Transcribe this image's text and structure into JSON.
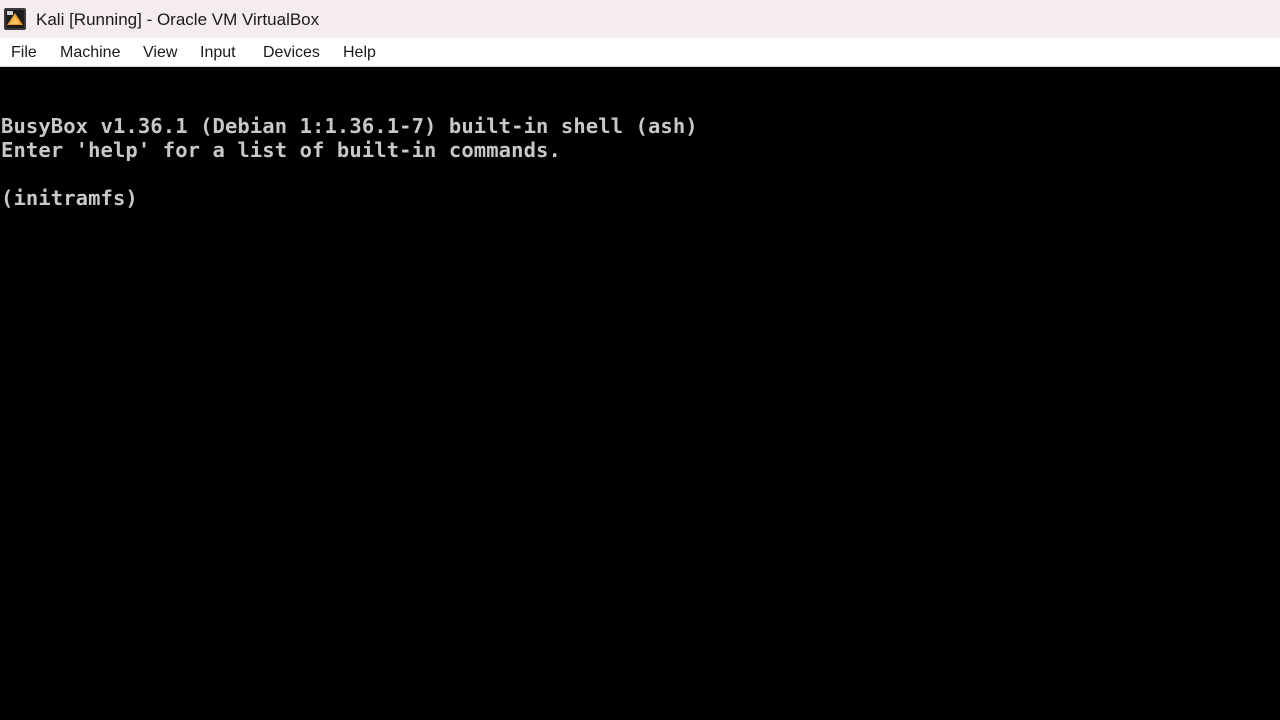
{
  "window": {
    "title": "Kali [Running] - Oracle VM VirtualBox",
    "icon": "virtualbox-icon"
  },
  "menubar": {
    "items": [
      {
        "label": "File"
      },
      {
        "label": "Machine"
      },
      {
        "label": "View"
      },
      {
        "label": "Input"
      },
      {
        "label": "Devices"
      },
      {
        "label": "Help"
      }
    ]
  },
  "console": {
    "lines": [
      "BusyBox v1.36.1 (Debian 1:1.36.1-7) built-in shell (ash)",
      "Enter 'help' for a list of built-in commands.",
      "",
      "(initramfs)"
    ],
    "text_color": "#c8c8c8",
    "background_color": "#000000"
  }
}
